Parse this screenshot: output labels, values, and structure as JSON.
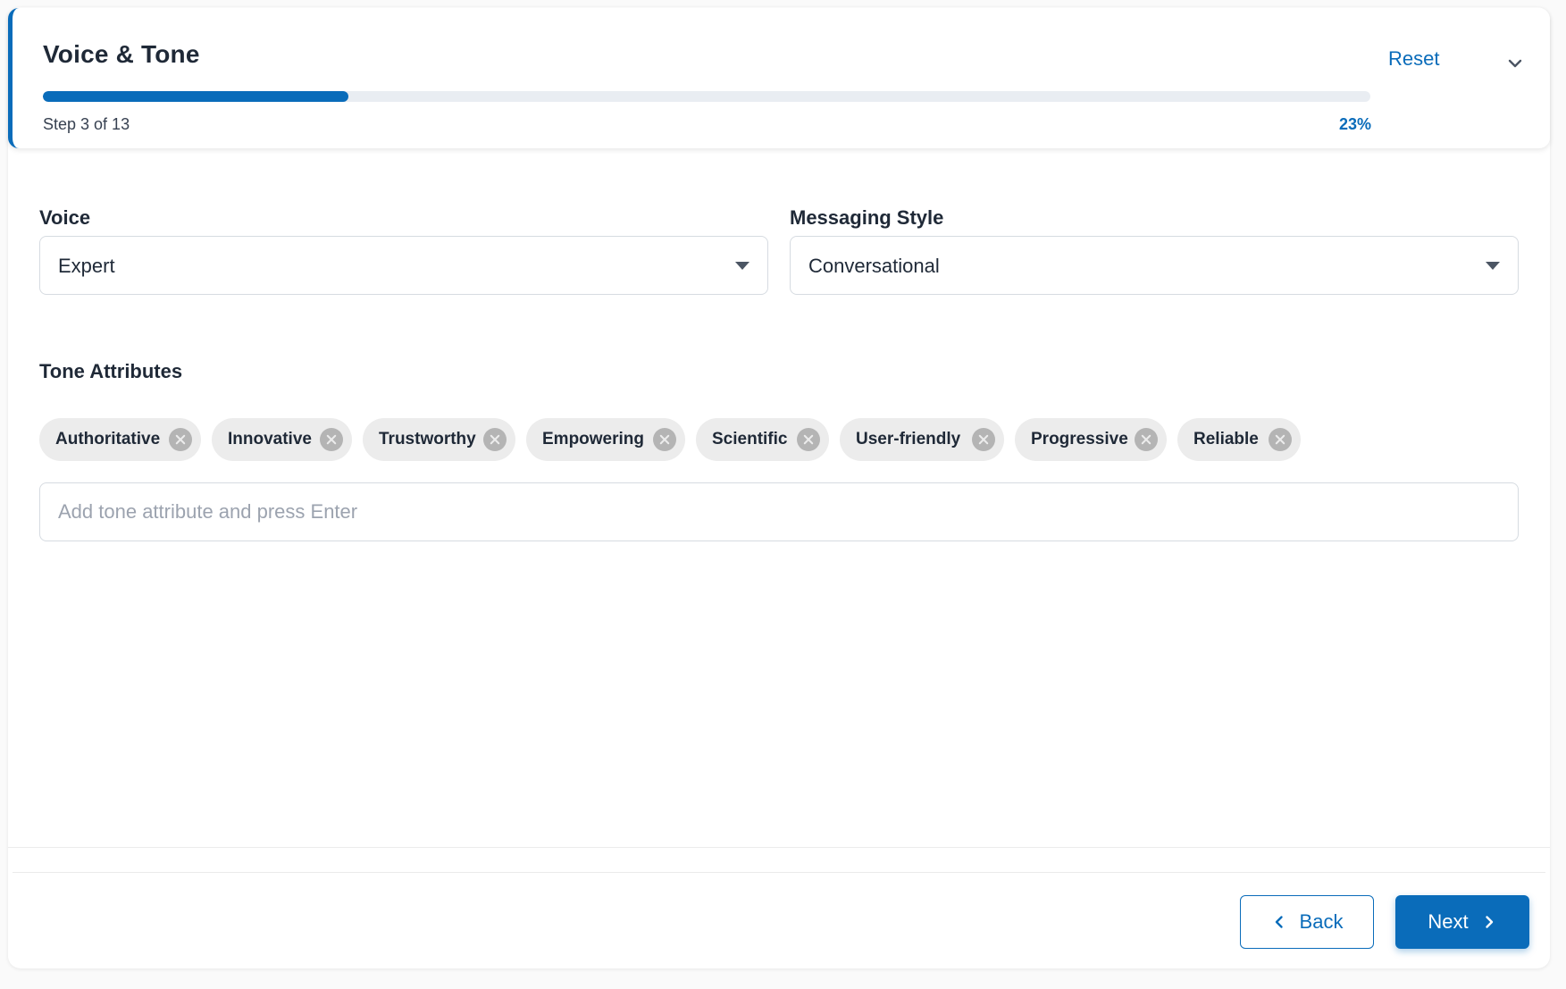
{
  "header": {
    "title": "Voice & Tone",
    "reset_label": "Reset",
    "step_text": "Step 3 of 13",
    "progress_percent_text": "23%",
    "progress_fraction": 0.23,
    "collapse_icon": "chevron-down-icon"
  },
  "voice": {
    "label": "Voice",
    "value": "Expert"
  },
  "messaging_style": {
    "label": "Messaging Style",
    "value": "Conversational"
  },
  "tone_attributes": {
    "label": "Tone Attributes",
    "chips": [
      "Authoritative",
      "Innovative",
      "Trustworthy",
      "Empowering",
      "Scientific",
      "User-friendly",
      "Progressive",
      "Reliable"
    ],
    "input_placeholder": "Add tone attribute and press Enter",
    "input_value": ""
  },
  "footer": {
    "back_label": "Back",
    "next_label": "Next"
  },
  "colors": {
    "accent": "#0a6cba",
    "chip_bg": "#ececec",
    "border": "#d6dbe1"
  }
}
